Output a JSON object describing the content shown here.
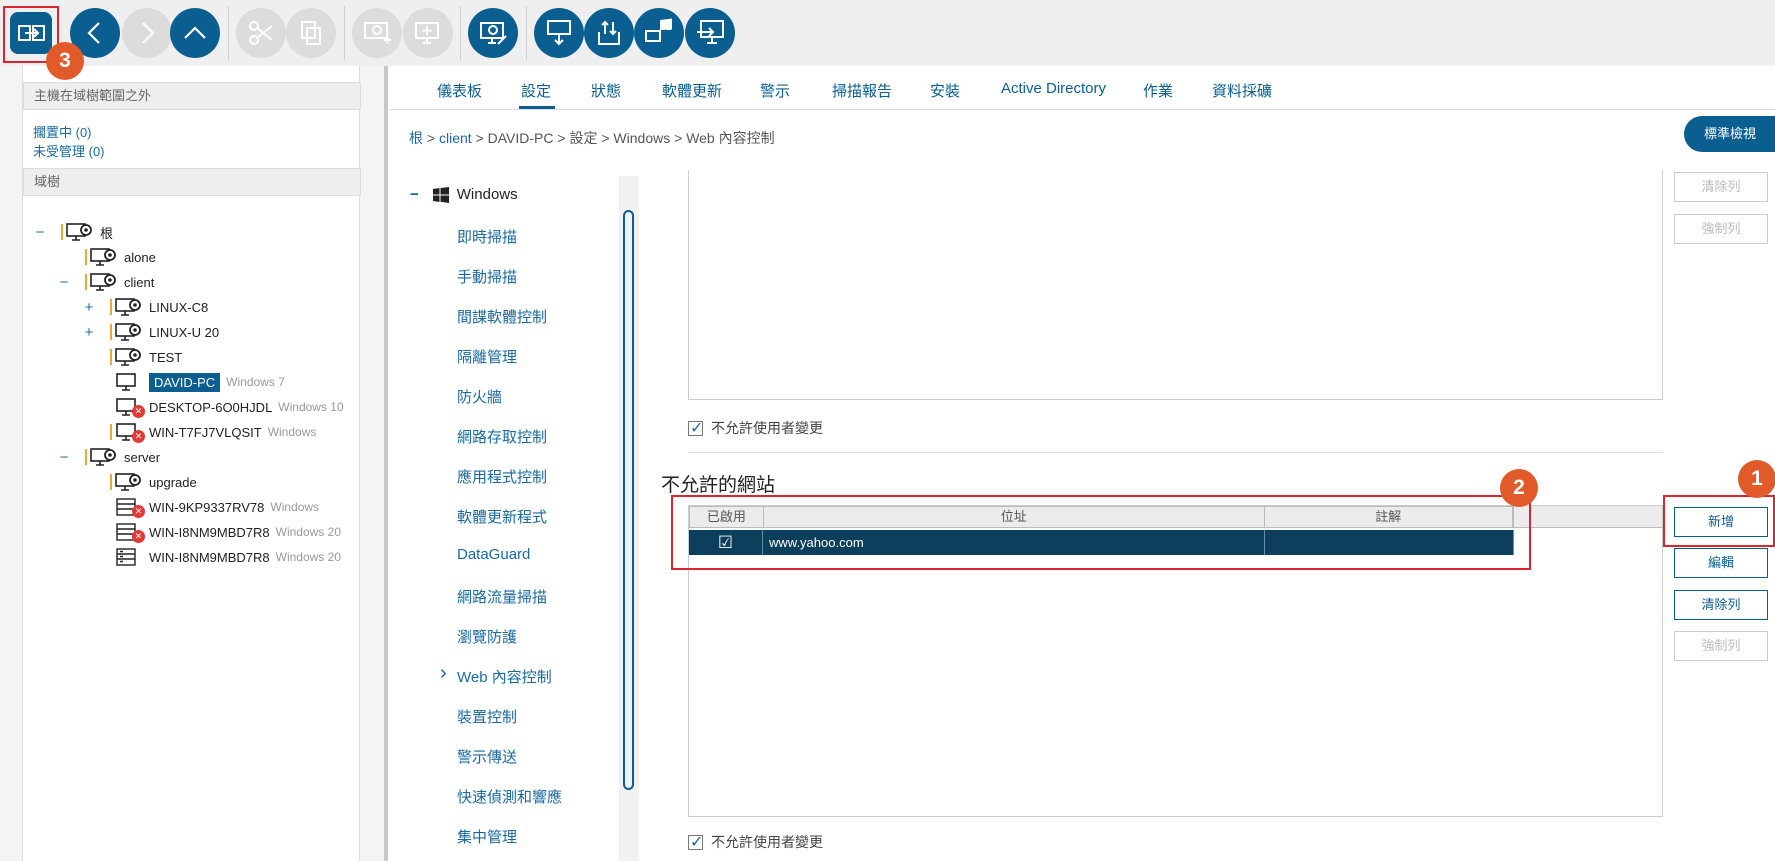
{
  "toolbar": {
    "buttons": [
      {
        "icon": "move-to-icon",
        "enabled": true
      },
      {
        "icon": "back-icon",
        "enabled": true
      },
      {
        "icon": "forward-icon",
        "enabled": false
      },
      {
        "icon": "up-icon",
        "enabled": true
      },
      {
        "icon": "cut-icon",
        "enabled": false
      },
      {
        "icon": "copy-icon",
        "enabled": false
      },
      {
        "icon": "add-host-icon",
        "enabled": false
      },
      {
        "icon": "add-group-icon",
        "enabled": false
      },
      {
        "icon": "host-settings-icon",
        "enabled": true
      },
      {
        "icon": "deploy-icon",
        "enabled": true
      },
      {
        "icon": "import-export-icon",
        "enabled": true
      },
      {
        "icon": "windows-host-icon",
        "enabled": true
      },
      {
        "icon": "move-host-icon",
        "enabled": true
      }
    ]
  },
  "left": {
    "outside_header": "主機在域樹範圍之外",
    "pending": "擱置中 (0)",
    "unmanaged": "未受管理 (0)",
    "tree_header": "域樹",
    "tree": [
      {
        "label": "根",
        "os": "",
        "toggle": "−",
        "status": "group"
      },
      {
        "label": "alone",
        "os": "",
        "toggle": "",
        "status": "group"
      },
      {
        "label": "client",
        "os": "",
        "toggle": "−",
        "status": "group"
      },
      {
        "label": "LINUX-C8",
        "os": "",
        "toggle": "+",
        "status": "group"
      },
      {
        "label": "LINUX-U 20",
        "os": "",
        "toggle": "+",
        "status": "group"
      },
      {
        "label": "TEST",
        "os": "",
        "toggle": "",
        "status": "group"
      },
      {
        "label": "DAVID-PC",
        "os": "Windows 7",
        "toggle": "",
        "status": "selected"
      },
      {
        "label": "DESKTOP-6O0HJDL",
        "os": "Windows 10",
        "toggle": "",
        "status": "error"
      },
      {
        "label": "WIN-T7FJ7VLQSIT",
        "os": "Windows",
        "toggle": "",
        "status": "error"
      },
      {
        "label": "server",
        "os": "",
        "toggle": "−",
        "status": "group"
      },
      {
        "label": "upgrade",
        "os": "",
        "toggle": "",
        "status": "group"
      },
      {
        "label": "WIN-9KP9337RV78",
        "os": "Windows",
        "toggle": "",
        "status": "error"
      },
      {
        "label": "WIN-I8NM9MBD7R8",
        "os": "Windows 20",
        "toggle": "",
        "status": "error"
      },
      {
        "label": "WIN-I8NM9MBD7R8",
        "os": "Windows 20",
        "toggle": "",
        "status": "server"
      }
    ]
  },
  "tabs": [
    "儀表板",
    "設定",
    "狀態",
    "軟體更新",
    "警示",
    "掃描報告",
    "安裝",
    "Active Directory",
    "作業",
    "資料採礦"
  ],
  "active_tab": "設定",
  "breadcrumb": {
    "root": "根",
    "sep": " > ",
    "client": "client",
    "host": "DAVID-PC",
    "settings": "設定",
    "windows": "Windows",
    "page": "Web 內容控制"
  },
  "std_view": "標準檢視",
  "nav": {
    "head": "Windows",
    "collapse": "−",
    "items": [
      "即時掃描",
      "手動掃描",
      "間諜軟體控制",
      "隔離管理",
      "防火牆",
      "網路存取控制",
      "應用程式控制",
      "軟體更新程式",
      "DataGuard",
      "網路流量掃描",
      "瀏覽防護",
      "Web 內容控制",
      "裝置控制",
      "警示傳送",
      "快速偵測和響應",
      "集中管理"
    ],
    "current": "Web 內容控制"
  },
  "content": {
    "checkbox_label_1": "不允許使用者變更",
    "blocked_title": "不允許的網站",
    "columns": [
      "已啟用",
      "位址",
      "註解"
    ],
    "rows": [
      {
        "enabled": "☑",
        "address": "www.yahoo.com",
        "comment": ""
      }
    ],
    "checkbox_label_2": "不允許使用者變更"
  },
  "side_buttons_top": [
    "清除列",
    "強制列"
  ],
  "side_buttons": [
    "新增",
    "編輯",
    "清除列",
    "強制列"
  ],
  "badges": [
    "1",
    "2",
    "3"
  ],
  "colors": {
    "accent": "#0b5e90",
    "highlight": "#d9262e",
    "badge": "#e05a2a"
  }
}
